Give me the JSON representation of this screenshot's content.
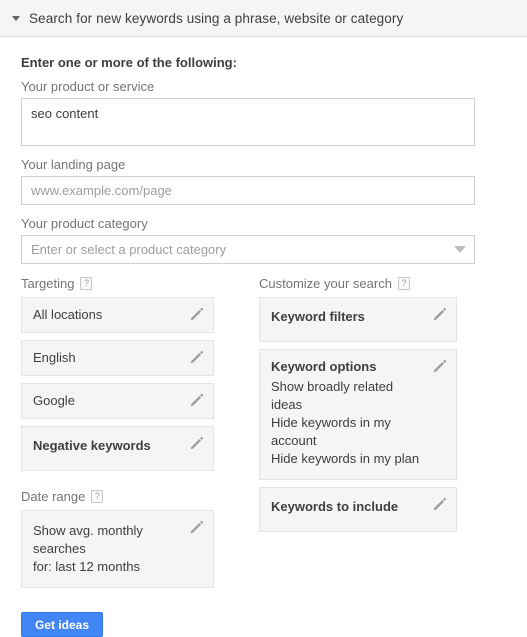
{
  "header": {
    "title": "Search for new keywords using a phrase, website or category",
    "collapse_icon": "triangle-down-icon"
  },
  "form": {
    "heading": "Enter one or more of the following:",
    "product_or_service": {
      "label": "Your product or service",
      "value": "seo content",
      "placeholder": ""
    },
    "landing_page": {
      "label": "Your landing page",
      "value": "",
      "placeholder": "www.example.com/page"
    },
    "product_category": {
      "label": "Your product category",
      "value": "",
      "placeholder": "Enter or select a product category",
      "arrow_icon": "chevron-down-icon"
    }
  },
  "targeting": {
    "label": "Targeting",
    "help": "?",
    "items": [
      {
        "text": "All locations",
        "bold": false,
        "edit_icon": "pencil-icon"
      },
      {
        "text": "English",
        "bold": false,
        "edit_icon": "pencil-icon"
      },
      {
        "text": "Google",
        "bold": false,
        "edit_icon": "pencil-icon"
      },
      {
        "text": "Negative keywords",
        "bold": true,
        "edit_icon": "pencil-icon"
      }
    ]
  },
  "date_range": {
    "label": "Date range",
    "help": "?",
    "line1": "Show avg. monthly searches",
    "line2": "for: last 12 months",
    "edit_icon": "pencil-icon"
  },
  "customize": {
    "label": "Customize your search",
    "help": "?",
    "keyword_filters": {
      "title": "Keyword filters",
      "edit_icon": "pencil-icon"
    },
    "keyword_options": {
      "title": "Keyword options",
      "edit_icon": "pencil-icon",
      "options": [
        "Show broadly related ideas",
        "Hide keywords in my account",
        "Hide keywords in my plan"
      ]
    },
    "keywords_to_include": {
      "title": "Keywords to include",
      "edit_icon": "pencil-icon"
    }
  },
  "actions": {
    "get_ideas_label": "Get ideas"
  },
  "colors": {
    "accent": "#4285f4",
    "header_bg": "#f5f5f5",
    "card_bg": "#f5f5f5",
    "text": "#3c4043",
    "label": "#757575"
  }
}
